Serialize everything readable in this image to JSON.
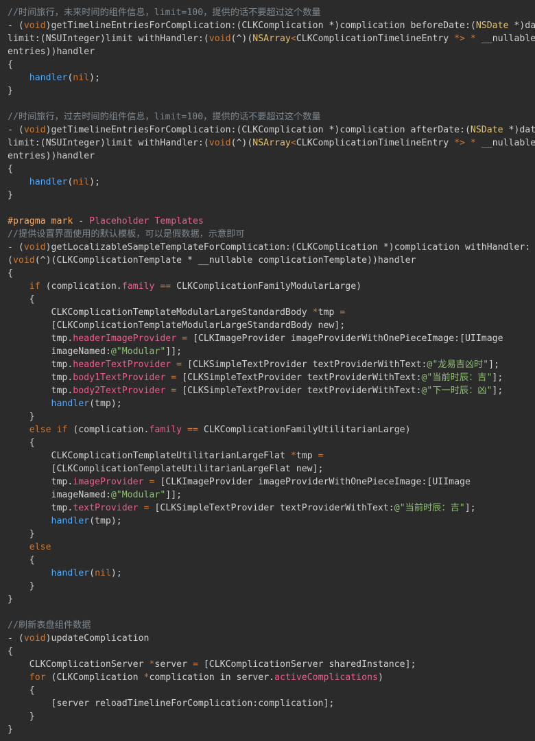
{
  "colors": {
    "background": "#2b2b2b",
    "plain": "#d2d2d2",
    "comment": "#7e8890",
    "keyword": "#cc7832",
    "type": "#e4c26e",
    "function": "#56a8f5",
    "property": "#ef5b8e",
    "string": "#8dc26f",
    "pragma": "#ffa657"
  },
  "lines": [
    [
      [
        "c",
        "//时间旅行，未来时间的组件信息，limit=100，提供的话不要超过这个数量"
      ]
    ],
    [
      [
        "p",
        "- ("
      ],
      [
        "k",
        "void"
      ],
      [
        "p",
        ")getTimelineEntriesForComplication:(CLKComplication *)complication beforeDate:("
      ],
      [
        "y",
        "NSDate"
      ],
      [
        "p",
        " *)date"
      ]
    ],
    [
      [
        "p",
        "limit:(NSUInteger)limit withHandler:("
      ],
      [
        "k",
        "void"
      ],
      [
        "p",
        "(^)("
      ],
      [
        "y",
        "NSArray"
      ],
      [
        "k",
        "<"
      ],
      [
        "p",
        "CLKComplicationTimelineEntry "
      ],
      [
        "k",
        "*>"
      ],
      [
        "p",
        " "
      ],
      [
        "k",
        "*"
      ],
      [
        "p",
        " __nullable"
      ]
    ],
    [
      [
        "p",
        "entries))handler"
      ]
    ],
    [
      [
        "p",
        "{"
      ]
    ],
    [
      [
        "p",
        "    "
      ],
      [
        "f",
        "handler"
      ],
      [
        "p",
        "("
      ],
      [
        "k",
        "nil"
      ],
      [
        "p",
        ");"
      ]
    ],
    [
      [
        "p",
        "}"
      ]
    ],
    [],
    [
      [
        "c",
        "//时间旅行，过去时间的组件信息，limit=100，提供的话不要超过这个数量"
      ]
    ],
    [
      [
        "p",
        "- ("
      ],
      [
        "k",
        "void"
      ],
      [
        "p",
        ")getTimelineEntriesForComplication:(CLKComplication *)complication afterDate:("
      ],
      [
        "y",
        "NSDate"
      ],
      [
        "p",
        " *)date"
      ]
    ],
    [
      [
        "p",
        "limit:(NSUInteger)limit withHandler:("
      ],
      [
        "k",
        "void"
      ],
      [
        "p",
        "(^)("
      ],
      [
        "y",
        "NSArray"
      ],
      [
        "k",
        "<"
      ],
      [
        "p",
        "CLKComplicationTimelineEntry "
      ],
      [
        "k",
        "*>"
      ],
      [
        "p",
        " "
      ],
      [
        "k",
        "*"
      ],
      [
        "p",
        " __nullable"
      ]
    ],
    [
      [
        "p",
        "entries))handler"
      ]
    ],
    [
      [
        "p",
        "{"
      ]
    ],
    [
      [
        "p",
        "    "
      ],
      [
        "f",
        "handler"
      ],
      [
        "p",
        "("
      ],
      [
        "k",
        "nil"
      ],
      [
        "p",
        ");"
      ]
    ],
    [
      [
        "p",
        "}"
      ]
    ],
    [],
    [
      [
        "m",
        "#pragma mark"
      ],
      [
        "p",
        " - "
      ],
      [
        "pr",
        "Placeholder Templates"
      ]
    ],
    [
      [
        "c",
        "//提供设置界面使用的默认模板，可以是假数据，示意即可"
      ]
    ],
    [
      [
        "p",
        "- ("
      ],
      [
        "k",
        "void"
      ],
      [
        "p",
        ")getLocalizableSampleTemplateForComplication:(CLKComplication *)complication withHandler:"
      ]
    ],
    [
      [
        "p",
        "("
      ],
      [
        "k",
        "void"
      ],
      [
        "p",
        "(^)(CLKComplicationTemplate * __nullable complicationTemplate))handler"
      ]
    ],
    [
      [
        "p",
        "{"
      ]
    ],
    [
      [
        "p",
        "    "
      ],
      [
        "k",
        "if"
      ],
      [
        "p",
        " (complication."
      ],
      [
        "pr",
        "family"
      ],
      [
        "p",
        " "
      ],
      [
        "k",
        "=="
      ],
      [
        "p",
        " CLKComplicationFamilyModularLarge)"
      ]
    ],
    [
      [
        "p",
        "    {"
      ]
    ],
    [
      [
        "p",
        "        CLKComplicationTemplateModularLargeStandardBody "
      ],
      [
        "k",
        "*"
      ],
      [
        "p",
        "tmp "
      ],
      [
        "k",
        "="
      ]
    ],
    [
      [
        "p",
        "        [CLKComplicationTemplateModularLargeStandardBody new];"
      ]
    ],
    [
      [
        "p",
        "        tmp."
      ],
      [
        "pr",
        "headerImageProvider"
      ],
      [
        "p",
        " "
      ],
      [
        "k",
        "="
      ],
      [
        "p",
        " [CLKImageProvider imageProviderWithOnePieceImage:[UIImage"
      ]
    ],
    [
      [
        "p",
        "        imageNamed:"
      ],
      [
        "s",
        "@\"Modular\""
      ],
      [
        "p",
        "]];"
      ]
    ],
    [
      [
        "p",
        "        tmp."
      ],
      [
        "pr",
        "headerTextProvider"
      ],
      [
        "p",
        " "
      ],
      [
        "k",
        "="
      ],
      [
        "p",
        " [CLKSimpleTextProvider textProviderWithText:"
      ],
      [
        "s",
        "@\"龙易吉凶时\""
      ],
      [
        "p",
        "];"
      ]
    ],
    [
      [
        "p",
        "        tmp."
      ],
      [
        "pr",
        "body1TextProvider"
      ],
      [
        "p",
        " "
      ],
      [
        "k",
        "="
      ],
      [
        "p",
        " [CLKSimpleTextProvider textProviderWithText:"
      ],
      [
        "s",
        "@\"当前时辰：吉\""
      ],
      [
        "p",
        "];"
      ]
    ],
    [
      [
        "p",
        "        tmp."
      ],
      [
        "pr",
        "body2TextProvider"
      ],
      [
        "p",
        " "
      ],
      [
        "k",
        "="
      ],
      [
        "p",
        " [CLKSimpleTextProvider textProviderWithText:"
      ],
      [
        "s",
        "@\"下一时辰：凶\""
      ],
      [
        "p",
        "];"
      ]
    ],
    [
      [
        "p",
        "        "
      ],
      [
        "f",
        "handler"
      ],
      [
        "p",
        "(tmp);"
      ]
    ],
    [
      [
        "p",
        "    }"
      ]
    ],
    [
      [
        "p",
        "    "
      ],
      [
        "k",
        "else if"
      ],
      [
        "p",
        " (complication."
      ],
      [
        "pr",
        "family"
      ],
      [
        "p",
        " "
      ],
      [
        "k",
        "=="
      ],
      [
        "p",
        " CLKComplicationFamilyUtilitarianLarge)"
      ]
    ],
    [
      [
        "p",
        "    {"
      ]
    ],
    [
      [
        "p",
        "        CLKComplicationTemplateUtilitarianLargeFlat "
      ],
      [
        "k",
        "*"
      ],
      [
        "p",
        "tmp "
      ],
      [
        "k",
        "="
      ]
    ],
    [
      [
        "p",
        "        [CLKComplicationTemplateUtilitarianLargeFlat new];"
      ]
    ],
    [
      [
        "p",
        "        tmp."
      ],
      [
        "pr",
        "imageProvider"
      ],
      [
        "p",
        " "
      ],
      [
        "k",
        "="
      ],
      [
        "p",
        " [CLKImageProvider imageProviderWithOnePieceImage:[UIImage"
      ]
    ],
    [
      [
        "p",
        "        imageNamed:"
      ],
      [
        "s",
        "@\"Modular\""
      ],
      [
        "p",
        "]];"
      ]
    ],
    [
      [
        "p",
        "        tmp."
      ],
      [
        "pr",
        "textProvider"
      ],
      [
        "p",
        " "
      ],
      [
        "k",
        "="
      ],
      [
        "p",
        " [CLKSimpleTextProvider textProviderWithText:"
      ],
      [
        "s",
        "@\"当前时辰：吉\""
      ],
      [
        "p",
        "];"
      ]
    ],
    [
      [
        "p",
        "        "
      ],
      [
        "f",
        "handler"
      ],
      [
        "p",
        "(tmp);"
      ]
    ],
    [
      [
        "p",
        "    }"
      ]
    ],
    [
      [
        "p",
        "    "
      ],
      [
        "k",
        "else"
      ]
    ],
    [
      [
        "p",
        "    {"
      ]
    ],
    [
      [
        "p",
        "        "
      ],
      [
        "f",
        "handler"
      ],
      [
        "p",
        "("
      ],
      [
        "k",
        "nil"
      ],
      [
        "p",
        ");"
      ]
    ],
    [
      [
        "p",
        "    }"
      ]
    ],
    [
      [
        "p",
        "}"
      ]
    ],
    [],
    [
      [
        "c",
        "//刷新表盘组件数据"
      ]
    ],
    [
      [
        "p",
        "- ("
      ],
      [
        "k",
        "void"
      ],
      [
        "p",
        ")updateComplication"
      ]
    ],
    [
      [
        "p",
        "{"
      ]
    ],
    [
      [
        "p",
        "    CLKComplicationServer "
      ],
      [
        "k",
        "*"
      ],
      [
        "p",
        "server "
      ],
      [
        "k",
        "="
      ],
      [
        "p",
        " [CLKComplicationServer sharedInstance];"
      ]
    ],
    [
      [
        "p",
        "    "
      ],
      [
        "k",
        "for"
      ],
      [
        "p",
        " (CLKComplication "
      ],
      [
        "k",
        "*"
      ],
      [
        "p",
        "complication in server."
      ],
      [
        "pr",
        "activeComplications"
      ],
      [
        "p",
        ")"
      ]
    ],
    [
      [
        "p",
        "    {"
      ]
    ],
    [
      [
        "p",
        "        [server reloadTimelineForComplication:complication];"
      ]
    ],
    [
      [
        "p",
        "    }"
      ]
    ],
    [
      [
        "p",
        "}"
      ]
    ]
  ]
}
